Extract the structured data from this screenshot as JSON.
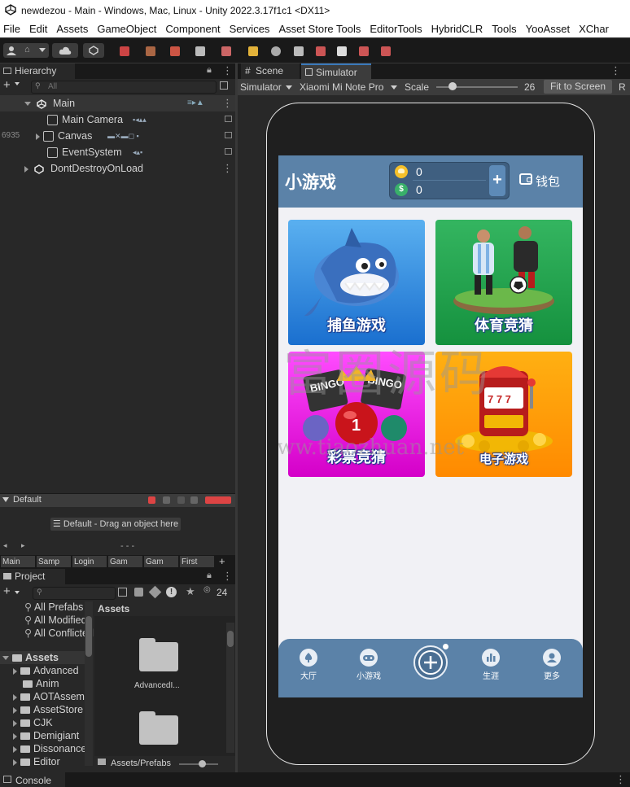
{
  "window": {
    "title": "newdezou - Main - Windows, Mac, Linux - Unity 2022.3.17f1c1 <DX11>"
  },
  "menu": [
    "File",
    "Edit",
    "Assets",
    "GameObject",
    "Component",
    "Services",
    "Asset Store Tools",
    "EditorTools",
    "HybridCLR",
    "Tools",
    "YooAsset",
    "XChar"
  ],
  "hierarchy": {
    "tab_label": "Hierarchy",
    "search_placeholder": "All",
    "scene_name": "Main",
    "children": [
      "Main Camera",
      "Canvas",
      "EventSystem"
    ],
    "side_number": "6935",
    "dontdestroy": "DontDestroyOnLoad"
  },
  "default_panel": {
    "title": "Default",
    "drop_hint": "Default - Drag an object here",
    "dashes": "- - -",
    "scene_tabs": [
      "Main",
      "Samp",
      "Login",
      "Gam",
      "Gam",
      "First"
    ]
  },
  "project": {
    "tab_label": "Project",
    "visible_count": "24",
    "favorites": [
      "All Prefabs",
      "All Modified",
      "All Conflicted"
    ],
    "assets_label": "Assets",
    "folders": [
      "Advanced",
      "Anim",
      "AOTAssem",
      "AssetStore",
      "CJK",
      "Demigiant",
      "Dissonance",
      "Editor"
    ],
    "grid_header": "Assets",
    "grid_items": [
      "AdvancedI..."
    ],
    "footer_path": "Assets/Prefabs"
  },
  "sim": {
    "tabs": [
      "Scene",
      "Simulator"
    ],
    "mode": "Simulator",
    "device": "Xiaomi Mi Note Pro",
    "scale_label": "Scale",
    "scale_value": "26",
    "scale_fraction": 0.2,
    "fit_button": "Fit to Screen",
    "extra_button": "R"
  },
  "app": {
    "title": "小游戏",
    "gold": "0",
    "cash": "0",
    "plus": "+",
    "wallet": "钱包",
    "games": [
      {
        "label": "捕鱼游戏",
        "color_top": "#5ab0f0",
        "color_bottom": "#1a6fcf"
      },
      {
        "label": "体育竞猜",
        "color_top": "#34b560",
        "color_bottom": "#15913e"
      },
      {
        "label": "彩票竞猜",
        "color_top": "#ff4cff",
        "color_bottom": "#d400c8"
      },
      {
        "label": "电子游戏",
        "color_top": "#ffb012",
        "color_bottom": "#ff8a00"
      }
    ],
    "nav": [
      "大厅",
      "小游戏",
      "",
      "生涯",
      "更多"
    ]
  },
  "watermark": {
    "main": "玖富圈源码",
    "url": "www.tiaozhuan.net"
  },
  "console": {
    "tab_label": "Console"
  },
  "colors": {
    "unity_dark": "#282828",
    "unity_toolbar": "#191919",
    "app_blue": "#5b82a8",
    "selection_blue": "#3a79bb"
  }
}
